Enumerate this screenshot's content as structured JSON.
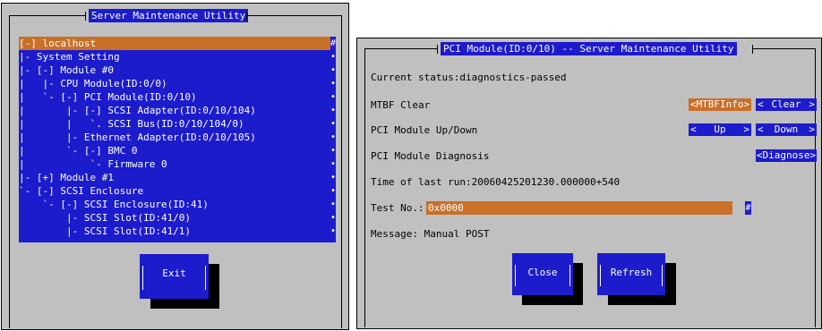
{
  "left_window": {
    "title": "Server Maintenance Utility",
    "tree": {
      "rows": [
        "[-] localhost",
        "|- System Setting",
        "|- [-] Module #0",
        "|   |- CPU Module(ID:0/0)",
        "|   `- [-] PCI Module(ID:0/10)",
        "|       |- [-] SCSI Adapter(ID:0/10/104)",
        "|       |   `. SCSI Bus(ID:0/10/104/0)",
        "|       |- Ethernet Adapter(ID:0/10/105)",
        "|       `- [-] BMC 0",
        "|           `- Firmware 0",
        "|- [+] Module #1",
        "`- [-] SCSI Enclosure",
        "    `- [-] SCSI Enclosure(ID:41)",
        "        |- SCSI Slot(ID:41/0)",
        "        |- SCSI Slot(ID:41/1)"
      ],
      "scroll_top": "#",
      "scroll_mark": "•"
    },
    "exit_label": "Exit"
  },
  "right_window": {
    "title": "PCI Module(ID:0/10) -- Server Maintenance Utility",
    "current_status": "Current status:diagnostics-passed",
    "mtbf_clear_label": "MTBF Clear",
    "mtbf_info_button": "<MTBFInfo>",
    "clear_button": {
      "left": "<",
      "text": "Clear",
      "right": ">"
    },
    "updown_label": "PCI Module Up/Down",
    "up_button": {
      "left": "<",
      "text": "Up",
      "right": ">"
    },
    "down_button": {
      "left": "<",
      "text": "Down",
      "right": ">"
    },
    "diagnosis_label": "PCI Module Diagnosis",
    "diagnose_button": "<Diagnose>",
    "last_run": "Time of last run:20060425201230.000000+540",
    "test_no_label": "Test No.:",
    "test_no_value": "0x0000",
    "test_no_hash": "#",
    "message": "Message: Manual POST",
    "close_label": "Close",
    "refresh_label": "Refresh"
  }
}
